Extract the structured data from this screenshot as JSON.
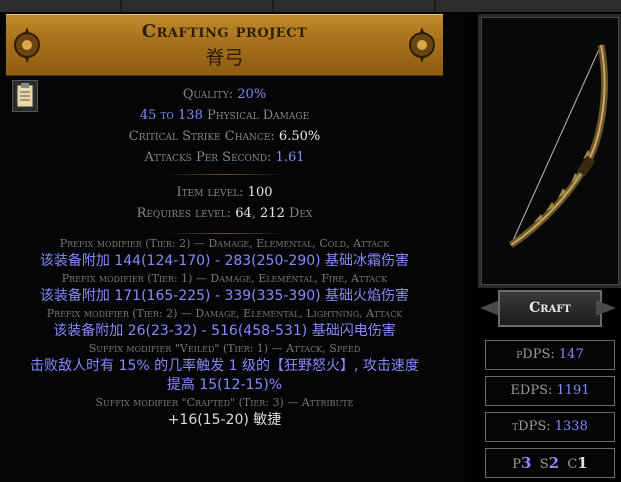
{
  "header": {
    "title": "Crafting project",
    "item_name": "脊弓"
  },
  "properties": {
    "quality_label": "Quality:",
    "quality_value": "20%",
    "damage_value": "45 to 138",
    "damage_label": "Physical Damage",
    "crit_label": "Critical Strike Chance:",
    "crit_value": "6.50%",
    "aps_label": "Attacks Per Second:",
    "aps_value": "1.61"
  },
  "requirements": {
    "item_level_label": "Item level:",
    "item_level_value": "100",
    "requires_label": "Requires level:",
    "requires_level": "64",
    "requires_sep": ",",
    "requires_dex_value": "212",
    "requires_dex_label": "Dex"
  },
  "modifiers": [
    {
      "header": "Prefix modifier (Tier: 2) — Damage, Elemental, Cold, Attack",
      "lines": [
        "该装备附加 144(124-170) - 283(250-290) 基础冰霜伤害"
      ]
    },
    {
      "header": "Prefix modifier (Tier: 1) — Damage, Elemental, Fire, Attack",
      "lines": [
        "该装备附加 171(165-225) - 339(335-390) 基础火焰伤害"
      ]
    },
    {
      "header": "Prefix modifier (Tier: 2) — Damage, Elemental, Lightning, Attack",
      "lines": [
        "该装备附加 26(23-32) - 516(458-531) 基础闪电伤害"
      ]
    },
    {
      "header": "Suffix modifier \"Veiled\" (Tier: 1) — Attack, Speed",
      "lines": [
        "击败敌人时有 15% 的几率触发 1 级的【狂野怒火】, 攻击速度",
        "提高 15(12-15)%"
      ]
    },
    {
      "header": "Suffix modifier \"Crafted\" (Tier: 3) — Attribute",
      "lines": [
        "+16(15-20) 敏捷"
      ]
    }
  ],
  "craft_button": "Craft",
  "dps": {
    "pdps_label": "pDPS:",
    "pdps_value": "147",
    "edps_label": "EDPS:",
    "edps_value": "1191",
    "tdps_label": "tDPS:",
    "tdps_value": "1338"
  },
  "affixes": {
    "p_label": "P",
    "p_value": "3",
    "s_label": "S",
    "s_value": "2",
    "c_label": "C",
    "c_value": "1"
  },
  "colors": {
    "header_gold": "#a9731c",
    "magic_blue": "#8888ff",
    "label_grey": "#858585"
  },
  "icons": [
    "clipboard-icon",
    "bow-item-image"
  ]
}
